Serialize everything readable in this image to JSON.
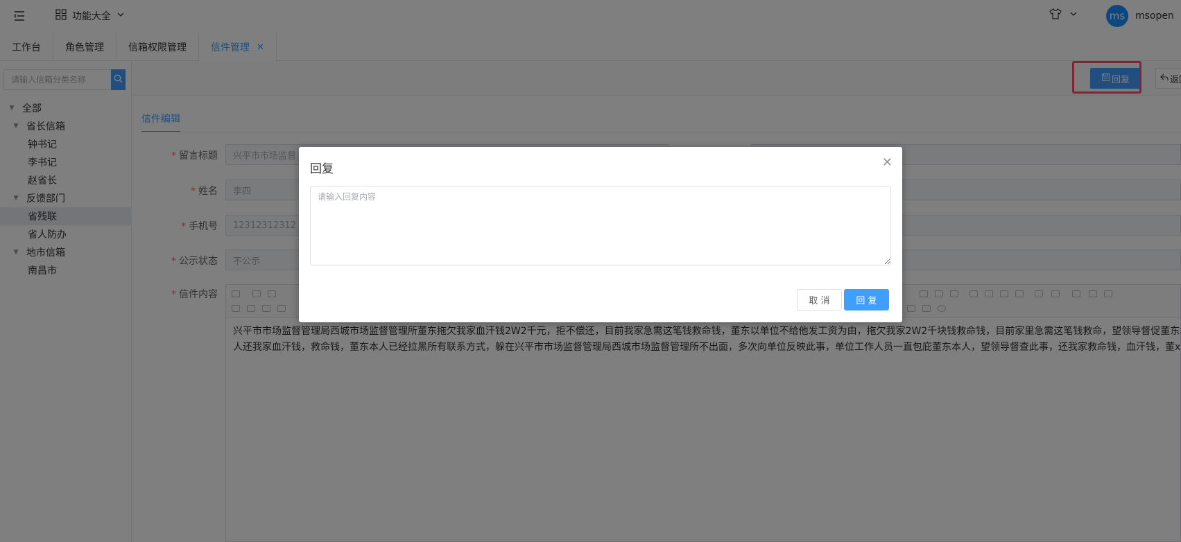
{
  "header": {
    "menu_label": "功能大全",
    "user_initials": "ms",
    "username": "msopen"
  },
  "tabs": [
    {
      "label": "工作台"
    },
    {
      "label": "角色管理"
    },
    {
      "label": "信箱权限管理"
    },
    {
      "label": "信件管理",
      "active": true
    }
  ],
  "sidebar": {
    "search_placeholder": "请输入信箱分类名称",
    "tree": {
      "all": "全部",
      "governor": "省长信箱",
      "zhong": "钟书记",
      "li": "李书记",
      "zhao": "赵省长",
      "feedback": "反馈部门",
      "canlian": "省残联",
      "renfang": "省人防办",
      "city": "地市信箱",
      "nanchang": "南昌市"
    }
  },
  "toolbar": {
    "reply_label": "回复",
    "back_label": "返回"
  },
  "form": {
    "section_tab": "信件编辑",
    "title_label": "留言标题",
    "title_value": "兴平市市场监督",
    "name_label": "姓名",
    "name_value": "李四",
    "phone_label": "手机号",
    "phone_value": "12312312312",
    "status_label": "公示状态",
    "status_value": "不公示",
    "content_label": "信件内容",
    "content_text": "兴平市市场监督管理局西城市场监督管理所董东拖欠我家血汗钱2W2千元，拒不偿还，目前我家急需这笔钱救命钱，董东以单位不给他发工资为由，拖欠我家2W2千块钱救命钱，目前家里急需这笔钱救命，望领导督促董东本人还我家血汗钱，救命钱，董东本人已经拉黑所有联系方式，躲在兴平市市场监督管理局西城市场监督管理所不出面，多次向单位反映此事，单位工作人员一直包庇董东本人，望领导督查此事，还我家救命钱，血汗钱，董xx"
  },
  "dialog": {
    "title": "回复",
    "placeholder": "请输入回复内容",
    "cancel_label": "取 消",
    "ok_label": "回 复"
  },
  "colors": {
    "primary": "#409eff",
    "highlight": "#ff4d6a",
    "required": "#f56c6c"
  }
}
